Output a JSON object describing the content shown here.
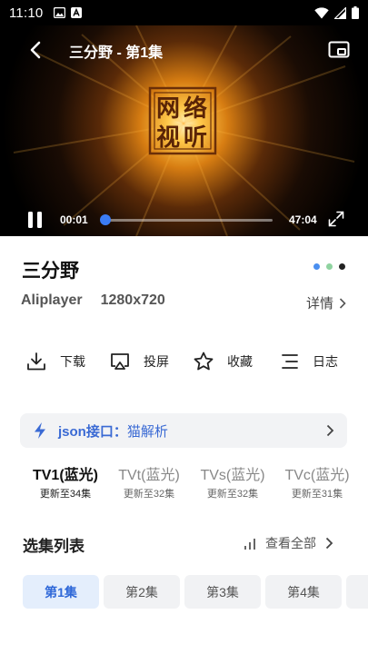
{
  "status_bar": {
    "time": "11:10"
  },
  "player": {
    "title": "三分野 - 第1集",
    "logo_text": "网络视听",
    "current_time": "00:01",
    "total_time": "47:04",
    "progress": 0.0004,
    "accent": "#3b7cf5"
  },
  "info": {
    "title": "三分野",
    "player_name": "Aliplayer",
    "resolution": "1280x720",
    "detail_label": "详情",
    "dot_colors": [
      "#4a8ff0",
      "#8fd3a0",
      "#222222"
    ]
  },
  "actions": [
    {
      "label": "下载",
      "icon": "download-icon"
    },
    {
      "label": "投屏",
      "icon": "cast-icon"
    },
    {
      "label": "收藏",
      "icon": "star-icon"
    },
    {
      "label": "日志",
      "icon": "log-icon"
    }
  ],
  "source": {
    "label": "json接口：",
    "value": "猫解析"
  },
  "lines": [
    {
      "name": "TV1(蓝光)",
      "count": "更新至34集",
      "active": true
    },
    {
      "name": "TVt(蓝光)",
      "count": "更新至32集",
      "active": false
    },
    {
      "name": "TVs(蓝光)",
      "count": "更新至32集",
      "active": false
    },
    {
      "name": "TVc(蓝光)",
      "count": "更新至31集",
      "active": false
    }
  ],
  "episodes": {
    "title": "选集列表",
    "see_all": "查看全部",
    "items": [
      "第1集",
      "第2集",
      "第3集",
      "第4集"
    ],
    "selected": "第1集"
  }
}
